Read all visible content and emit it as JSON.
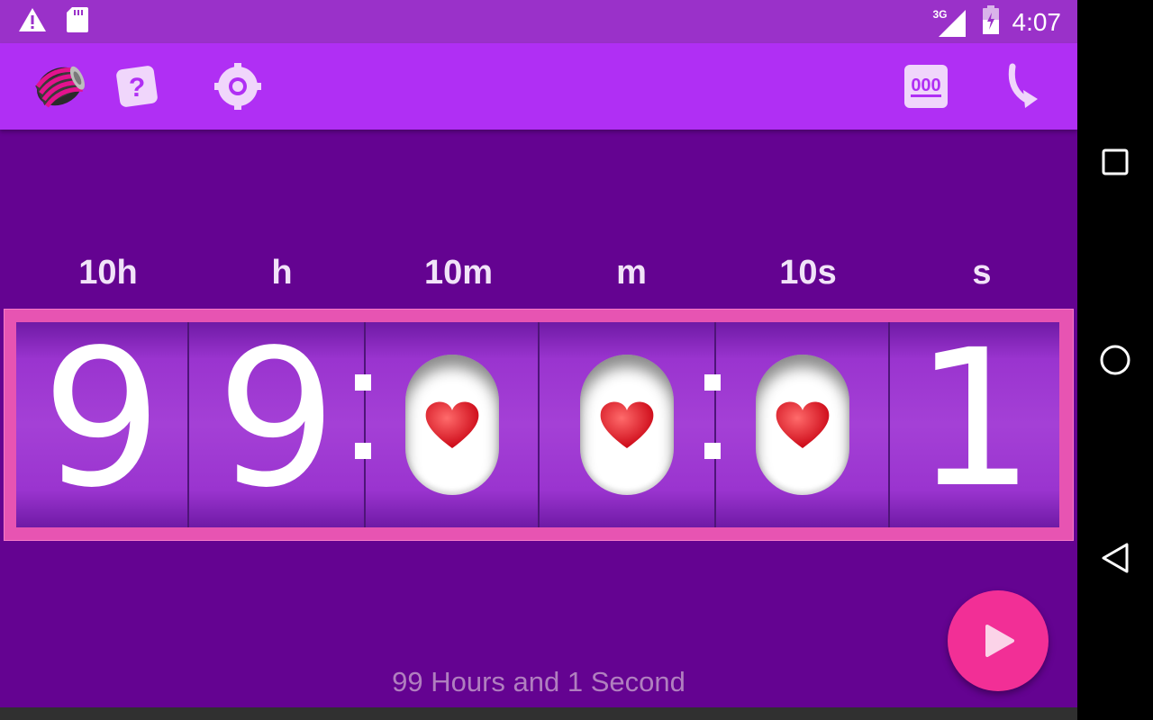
{
  "status_bar": {
    "time": "4:07",
    "network_label": "3G",
    "icons": [
      "warning-icon",
      "sd-card-icon",
      "signal-icon",
      "battery-icon"
    ]
  },
  "toolbar": {
    "icons": [
      "spring-app-icon",
      "help-icon",
      "settings-icon",
      "counter-format-icon",
      "share-icon"
    ],
    "format_label": "000"
  },
  "units": [
    "10h",
    "h",
    "10m",
    "m",
    "10s",
    "s"
  ],
  "digits": [
    "9",
    "9",
    "0",
    "0",
    "0",
    "1"
  ],
  "summary": "99 Hours and 1 Second",
  "colors": {
    "background": "#640391",
    "toolbar": "#b02ff4",
    "status_bar": "#9a31c9",
    "frame": "#e754b2",
    "accent": "#f22f96",
    "heart": "#e3121b"
  },
  "navigation": [
    "recents-button",
    "home-button",
    "back-button"
  ]
}
